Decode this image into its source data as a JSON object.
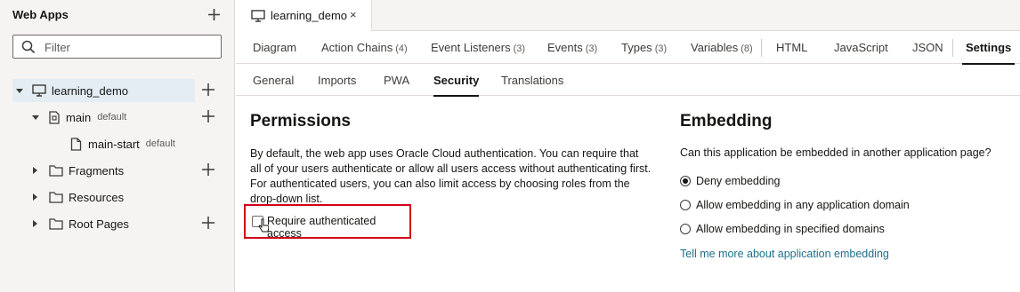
{
  "sidebar": {
    "title": "Web Apps",
    "search_placeholder": "Filter",
    "tree": [
      {
        "label": "learning_demo",
        "sub": ""
      },
      {
        "label": "main",
        "sub": "default"
      },
      {
        "label": "main-start",
        "sub": "default"
      },
      {
        "label": "Fragments",
        "sub": ""
      },
      {
        "label": "Resources",
        "sub": ""
      },
      {
        "label": "Root Pages",
        "sub": ""
      }
    ]
  },
  "file_tab": {
    "label": "learning_demo",
    "close": "×"
  },
  "tabs": [
    {
      "label": "Diagram",
      "count": ""
    },
    {
      "label": "Action Chains",
      "count": "(4)"
    },
    {
      "label": "Event Listeners",
      "count": "(3)"
    },
    {
      "label": "Events",
      "count": "(3)"
    },
    {
      "label": "Types",
      "count": "(3)"
    },
    {
      "label": "Variables",
      "count": "(8)"
    },
    {
      "label": "HTML",
      "count": ""
    },
    {
      "label": "JavaScript",
      "count": ""
    },
    {
      "label": "JSON",
      "count": ""
    },
    {
      "label": "Settings",
      "count": ""
    }
  ],
  "subtabs": [
    "General",
    "Imports",
    "PWA",
    "Security",
    "Translations"
  ],
  "permissions": {
    "heading": "Permissions",
    "paragraph": "By default, the web app uses Oracle Cloud authentication. You can require that all of your users authenticate or allow all users access without authenticating first. For authenticated users, you can also limit access by choosing roles from the drop-down list.",
    "checkbox_label": "Require authenticated access",
    "checkbox_checked": false
  },
  "embedding": {
    "heading": "Embedding",
    "question": "Can this application be embedded in another application page?",
    "options": [
      "Deny embedding",
      "Allow embedding in any application domain",
      "Allow embedding in specified domains"
    ],
    "selected": "Deny embedding",
    "link": "Tell me more about application embedding"
  },
  "colors": {
    "highlight": "#d0021b",
    "link": "#1f6f8b",
    "selected_row": "#e4edf4"
  }
}
